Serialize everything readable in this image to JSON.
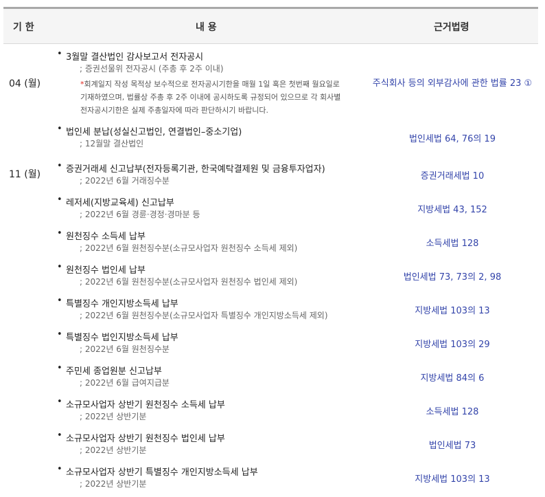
{
  "header": {
    "col_date": "기 한",
    "col_content": "내 용",
    "col_law": "근거법령"
  },
  "dates": [
    "04 (월)",
    "11 (월)"
  ],
  "items": [
    {
      "title": "3월말 결산법인 감사보고서 전자공시",
      "sub": "; 증권선물위 전자공시 (주총 후 2주 이내)",
      "law": "주식회사 등의 외부감사에 관한 법률 23 ①"
    },
    {
      "title": "법인세 분납(성실신고법인, 연결법인–중소기업)",
      "sub": "; 12월말 결산법인",
      "law": "법인세법 64, 76의 19"
    },
    {
      "title": "증권거래세 신고납부(전자등록기관, 한국예탁결제원 및 금융투자업자)",
      "sub": "; 2022년 6월 거래징수분",
      "law": "증권거래세법 10"
    },
    {
      "title": "레저세(지방교육세) 신고납부",
      "sub": "; 2022년 6월 경륜·경정·경마분 등",
      "law": "지방세법 43, 152"
    },
    {
      "title": "원천징수 소득세 납부",
      "sub": "; 2022년 6월 원천징수분(소규모사업자 원천징수 소득세 제외)",
      "law": "소득세법 128"
    },
    {
      "title": "원천징수 법인세 납부",
      "sub": "; 2022년 6월 원천징수분(소규모사업자 원천징수 법인세 제외)",
      "law": "법인세법 73, 73의 2, 98"
    },
    {
      "title": "특별징수 개인지방소득세 납부",
      "sub": "; 2022년 6월 원천징수분(소규모사업자 특별징수 개인지방소득세 제외)",
      "law": "지방세법 103의 13"
    },
    {
      "title": "특별징수 법인지방소득세 납부",
      "sub": "; 2022년 6월 원천징수분",
      "law": "지방세법 103의 29"
    },
    {
      "title": "주민세 종업원분 신고납부",
      "sub": "; 2022년 6월 급여지급분",
      "law": "지방세법 84의 6"
    },
    {
      "title": "소규모사업자 상반기 원천징수 소득세 납부",
      "sub": "; 2022년 상반기분",
      "law": "소득세법 128"
    },
    {
      "title": "소규모사업자 상반기 원천징수 법인세 납부",
      "sub": "; 2022년 상반기분",
      "law": "법인세법 73"
    },
    {
      "title": "소규모사업자 상반기 특별징수 개인지방소득세 납부",
      "sub": "; 2022년 상반기분",
      "law": "지방세법 103의 13"
    }
  ],
  "note": {
    "star": "*",
    "line1": "회계일지 작성 목적상 보수적으로 전자공시기한을 매월 1일 혹은 첫번째 월요일로",
    "line2": "기재하였으며, 법률상 주총 후 2주 이내에 공시하도록 규정되어 있으므로 각 회사별",
    "line3": "전자공시기한은 실제 주총일자에 따라 판단하시기 바랍니다."
  }
}
